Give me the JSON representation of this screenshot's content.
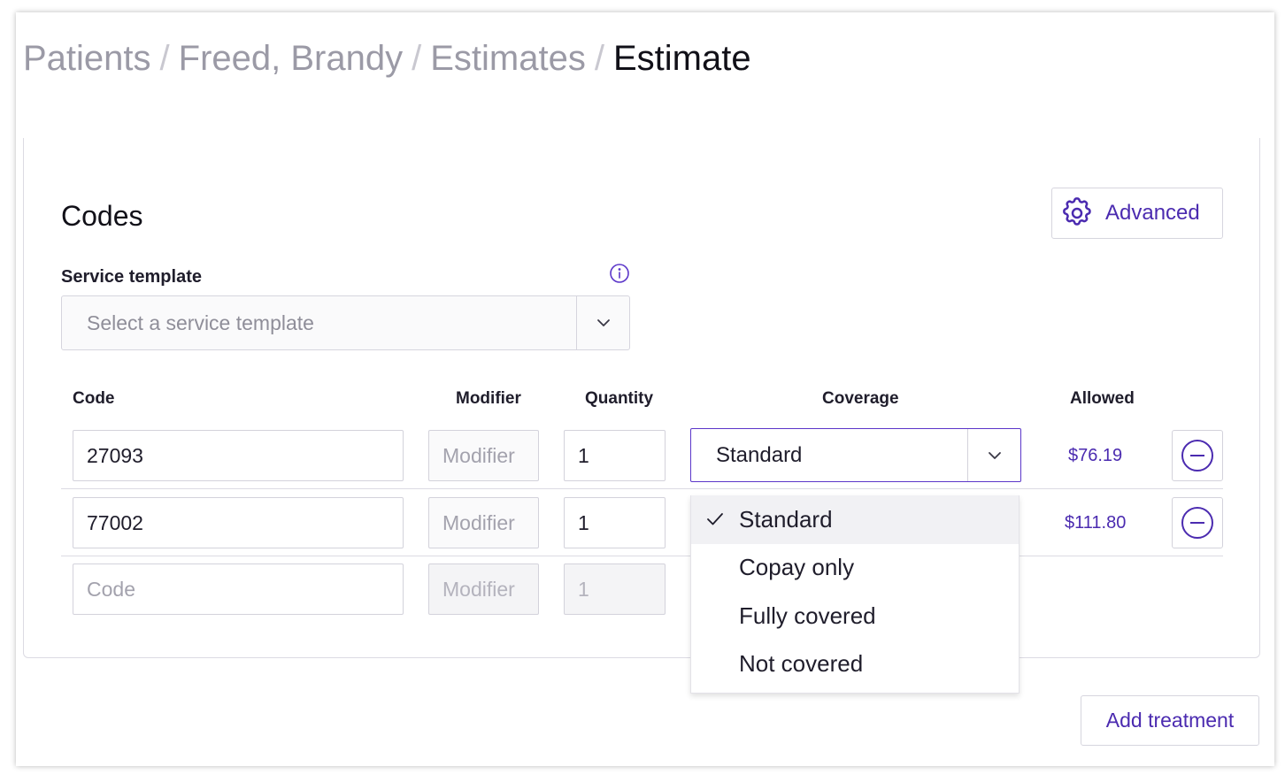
{
  "breadcrumb": {
    "items": [
      "Patients",
      "Freed, Brandy",
      "Estimates",
      "Estimate"
    ],
    "separator": "/"
  },
  "codes": {
    "title": "Codes",
    "advanced_label": "Advanced",
    "service_template": {
      "label": "Service template",
      "placeholder": "Select a service template"
    },
    "columns": {
      "code": "Code",
      "modifier": "Modifier",
      "quantity": "Quantity",
      "coverage": "Coverage",
      "allowed": "Allowed"
    },
    "rows": [
      {
        "code": "27093",
        "modifier_placeholder": "Modifier",
        "quantity": "1",
        "coverage": "Standard",
        "allowed": "$76.19"
      },
      {
        "code": "77002",
        "modifier_placeholder": "Modifier",
        "quantity": "1",
        "allowed": "$111.80"
      }
    ],
    "new_row": {
      "code_placeholder": "Code",
      "modifier_placeholder": "Modifier",
      "quantity_placeholder": "1"
    },
    "coverage_options": [
      "Standard",
      "Copay only",
      "Fully covered",
      "Not covered"
    ],
    "coverage_selected": "Standard"
  },
  "add_treatment_label": "Add treatment",
  "colors": {
    "accent": "#4b2bb0",
    "focus_border": "#5b36c9",
    "muted_text": "#9b9aa6"
  }
}
